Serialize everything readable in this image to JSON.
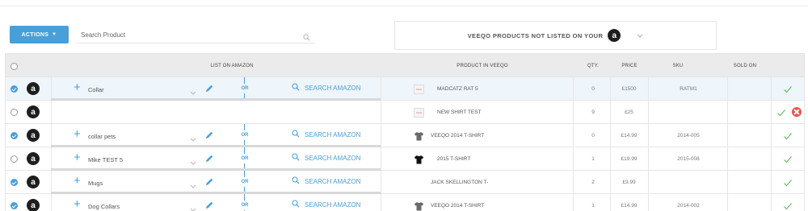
{
  "toolbar": {
    "actions_label": "ACTIONS",
    "search_placeholder": "Search Product"
  },
  "filter": {
    "label": "VEEQO PRODUCTS NOT LISTED ON YOUR",
    "channel_icon": "amazon-logo"
  },
  "table": {
    "headers": {
      "list_on_amazon": "LIST ON AMAZON",
      "product_in_veeqo": "PRODUCT IN VEEQO",
      "qty": "QTY.",
      "price": "PRICE",
      "sku": "SKU",
      "sold_on": "SOLD ON"
    },
    "or_label": "OR",
    "search_amazon_label": "SEARCH AMAZON",
    "rows": [
      {
        "selected": true,
        "listing": "Collar",
        "product": "MADCATZ RAT 5",
        "qty": "0",
        "price": "£1500",
        "sku": "RATM1",
        "image": "placeholder",
        "error": false,
        "show_listing": true
      },
      {
        "selected": false,
        "listing": "",
        "product": "NEW SHIRT TEST",
        "qty": "9",
        "price": "£25",
        "sku": "",
        "image": "placeholder",
        "error": true,
        "show_listing": false
      },
      {
        "selected": true,
        "listing": "collar pets",
        "product": "VEEQO 2014 T-SHIRT",
        "qty": "0",
        "price": "£14.99",
        "sku": "2014-005",
        "image": "grey-tshirt",
        "error": false,
        "show_listing": true
      },
      {
        "selected": false,
        "listing": "Mike TEST 5",
        "product": "2015 T-SHIRT",
        "qty": "1",
        "price": "£19.99",
        "sku": "2015-008",
        "image": "black-tshirt",
        "error": false,
        "show_listing": true
      },
      {
        "selected": true,
        "listing": "Mugs",
        "product": "JACK SKELLINGTON T-",
        "qty": "2",
        "price": "£9.99",
        "sku": "",
        "image": "none",
        "error": false,
        "show_listing": true
      },
      {
        "selected": true,
        "listing": "Dog Collars",
        "product": "VEEQO 2014 T-SHIRT",
        "qty": "1",
        "price": "£14.99",
        "sku": "2014-002",
        "image": "grey-tshirt",
        "error": false,
        "show_listing": true
      }
    ]
  },
  "colors": {
    "accent": "#4a9fd8",
    "success": "#5cb85c",
    "error": "#e2574c"
  }
}
